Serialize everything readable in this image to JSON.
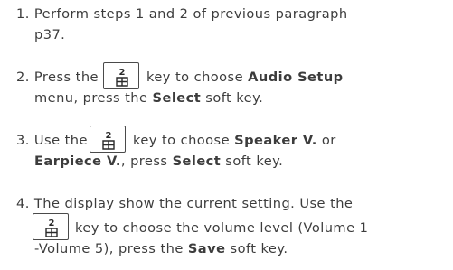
{
  "steps": [
    {
      "number": "1.",
      "line1": "Perform steps 1 and 2 of previous paragraph",
      "line2": "p37."
    },
    {
      "number": "2.",
      "press": "Press the",
      "after_key": "key to choose",
      "target": "Audio Setup",
      "line2_a": "menu, press the",
      "line2_b": "Select",
      "line2_c": "soft key."
    },
    {
      "number": "3.",
      "use": "Use the",
      "after_key": "key to choose",
      "target1": "Speaker V.",
      "or": "or",
      "target2": "Earpiece V.",
      "line2_rest": ", press",
      "select": "Select",
      "line2_end": "soft key."
    },
    {
      "number": "4.",
      "line1": "The display show the current setting. Use the",
      "after_key": "key to choose the volume level (Volume 1",
      "line3_a": "-Volume 5), press the",
      "save": "Save",
      "line3_c": "soft key."
    }
  ],
  "key_icon": "dial-2-abc-key-icon"
}
